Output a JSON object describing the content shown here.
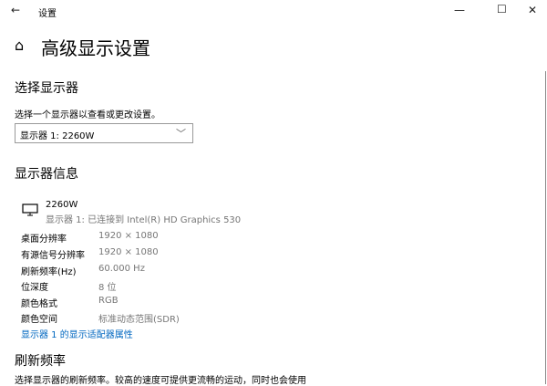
{
  "window": {
    "title": "设置",
    "back": "←",
    "minimize": "—",
    "maximize": "☐",
    "close": "✕"
  },
  "page": {
    "home_icon": "⌂",
    "title": "高级显示设置"
  },
  "select_display": {
    "heading": "选择显示器",
    "description": "选择一个显示器以查看或更改设置。",
    "dropdown_value": "显示器 1: 2260W",
    "chevron": "﹀"
  },
  "display_info": {
    "heading": "显示器信息",
    "monitor_name": "2260W",
    "connection": "显示器 1: 已连接到 Intel(R) HD Graphics 530",
    "rows": [
      {
        "label": "桌面分辨率",
        "value": "1920 × 1080"
      },
      {
        "label": "有源信号分辨率",
        "value": "1920 × 1080"
      },
      {
        "label": "刷新频率(Hz)",
        "value": "60.000 Hz"
      },
      {
        "label": "位深度",
        "value": "8 位"
      },
      {
        "label": "颜色格式",
        "value": "RGB"
      },
      {
        "label": "颜色空间",
        "value": "标准动态范围(SDR)"
      }
    ],
    "adapter_link": "显示器 1 的显示适配器属性"
  },
  "refresh_rate": {
    "heading": "刷新频率",
    "description": "选择显示器的刷新频率。较高的速度可提供更流畅的运动，同时也会使用"
  },
  "colors": {
    "link": "#0067c0"
  }
}
